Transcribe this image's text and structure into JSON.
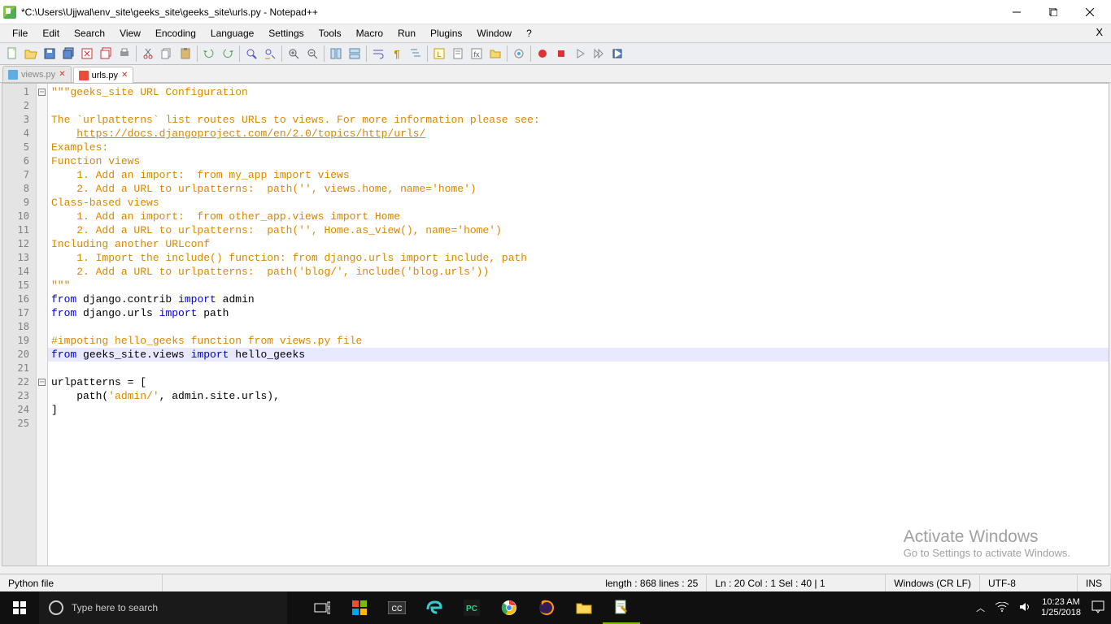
{
  "window": {
    "title": "*C:\\Users\\Ujjwal\\env_site\\geeks_site\\geeks_site\\urls.py - Notepad++"
  },
  "menu": [
    "File",
    "Edit",
    "Search",
    "View",
    "Encoding",
    "Language",
    "Settings",
    "Tools",
    "Macro",
    "Run",
    "Plugins",
    "Window",
    "?"
  ],
  "tabs": [
    {
      "name": "views.py",
      "active": false
    },
    {
      "name": "urls.py",
      "active": true
    }
  ],
  "code": {
    "lines": [
      [
        [
          "str",
          "\"\"\"geeks_site URL Configuration"
        ]
      ],
      [],
      [
        [
          "str",
          "The `urlpatterns` list routes URLs to views. For more information please see:"
        ]
      ],
      [
        [
          "str",
          "    "
        ],
        [
          "lnk",
          "https://docs.djangoproject.com/en/2.0/topics/http/urls/"
        ]
      ],
      [
        [
          "str",
          "Examples:"
        ]
      ],
      [
        [
          "str",
          "Function views"
        ]
      ],
      [
        [
          "str",
          "    1. Add an import:  from my_app import views"
        ]
      ],
      [
        [
          "str",
          "    2. Add a URL to urlpatterns:  path('', views.home, name='home')"
        ]
      ],
      [
        [
          "str",
          "Class-based views"
        ]
      ],
      [
        [
          "str",
          "    1. Add an import:  from other_app.views import Home"
        ]
      ],
      [
        [
          "str",
          "    2. Add a URL to urlpatterns:  path('', Home.as_view(), name='home')"
        ]
      ],
      [
        [
          "str",
          "Including another URLconf"
        ]
      ],
      [
        [
          "str",
          "    1. Import the include() function: from django.urls import include, path"
        ]
      ],
      [
        [
          "str",
          "    2. Add a URL to urlpatterns:  path('blog/', include('blog.urls'))"
        ]
      ],
      [
        [
          "str",
          "\"\"\""
        ]
      ],
      [
        [
          "kw",
          "from"
        ],
        [
          "nrm",
          " django.contrib "
        ],
        [
          "kw",
          "import"
        ],
        [
          "nrm",
          " admin"
        ]
      ],
      [
        [
          "kw",
          "from"
        ],
        [
          "nrm",
          " django.urls "
        ],
        [
          "kw",
          "import"
        ],
        [
          "nrm",
          " path"
        ]
      ],
      [],
      [
        [
          "com",
          "#impoting hello_geeks function from views.py file"
        ]
      ],
      [
        [
          "kw",
          "from"
        ],
        [
          "nrm",
          " geeks_site.views "
        ],
        [
          "kw",
          "import"
        ],
        [
          "nrm",
          " hello_geeks"
        ]
      ],
      [],
      [
        [
          "nrm",
          "urlpatterns = ["
        ]
      ],
      [
        [
          "nrm",
          "    path("
        ],
        [
          "str",
          "'admin/'"
        ],
        [
          "nrm",
          ", admin.site.urls),"
        ]
      ],
      [
        [
          "nrm",
          "]"
        ]
      ],
      []
    ],
    "highlight_line": 20
  },
  "status": {
    "file_type": "Python file",
    "length_lines": "length : 868    lines : 25",
    "cursor": "Ln : 20   Col : 1   Sel : 40 | 1",
    "eol": "Windows (CR LF)",
    "encoding": "UTF-8",
    "mode": "INS"
  },
  "watermark": {
    "heading": "Activate Windows",
    "sub": "Go to Settings to activate Windows."
  },
  "taskbar": {
    "search_placeholder": "Type here to search",
    "time": "10:23 AM",
    "date": "1/25/2018"
  }
}
